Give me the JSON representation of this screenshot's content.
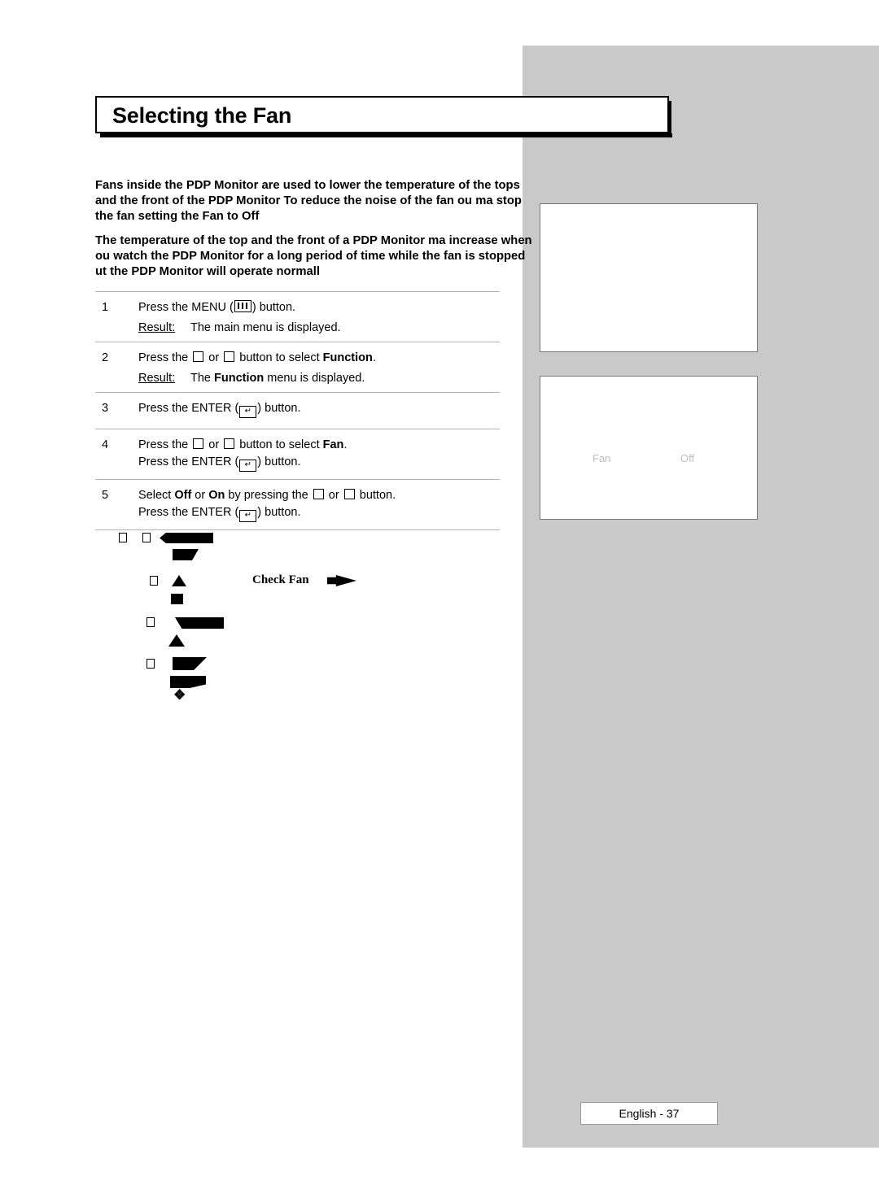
{
  "page": {
    "title": "Selecting the Fan",
    "footer_label": "English - 37"
  },
  "intro": {
    "paragraph1": "Fans inside the PDP Monitor are used to lower the temperature of the tops and the front of the PDP Monitor  To reduce the noise of the fan  ou ma  stop the fan    setting the Fan  to  Off",
    "paragraph2": "The temperature of the top and the front of a PDP Monitor ma  increase when  ou watch the PDP Monitor for a long period of time while the fan is stopped    ut the PDP Monitor will operate normall"
  },
  "steps": [
    {
      "num": "1",
      "lines": [
        "Press the MENU (",
        ") button."
      ],
      "icon": "menu-icon",
      "result_label": "Result:",
      "result_text": "The main menu is displayed."
    },
    {
      "num": "2",
      "pre": "Press the ",
      "mid": " or ",
      "post": " button to select Function",
      "post_tail": ".",
      "bold_word": "Function",
      "result_label": "Result:",
      "result_pre": "The ",
      "result_bold": "Function",
      "result_post": "  menu is displayed."
    },
    {
      "num": "3",
      "text_pre": "Press the ENTER (",
      "text_post": ") button."
    },
    {
      "num": "4",
      "line1_pre": "Press the ",
      "line1_mid": " or ",
      "line1_post": " button to select Fan",
      "line1_tail": ".",
      "line2_pre": "Press the ENTER (",
      "line2_post": ") button."
    },
    {
      "num": "5",
      "line1_pre": "Select ",
      "line1_off": "Off",
      "line1_or": " or ",
      "line1_on": "On",
      "line1_mid": " by pressing the ",
      "line1_mid2": " or ",
      "line1_post": " button.",
      "line2_pre": "Press the ENTER (",
      "line2_post": ") button."
    }
  ],
  "notes": {
    "check_fan": "Check Fan"
  },
  "osd": {
    "box1_rows": [],
    "box2_rows": [
      {
        "label": "Fan",
        "value": "Off"
      }
    ]
  },
  "icons": {
    "menu": "menu-icon",
    "enter": "enter-icon",
    "up": "up-arrow-icon",
    "down": "down-arrow-icon"
  },
  "colors": {
    "panel_grey": "#c9c9c9",
    "rule_grey": "#b4b4b4",
    "osd_text_grey": "#bdbdbd"
  }
}
